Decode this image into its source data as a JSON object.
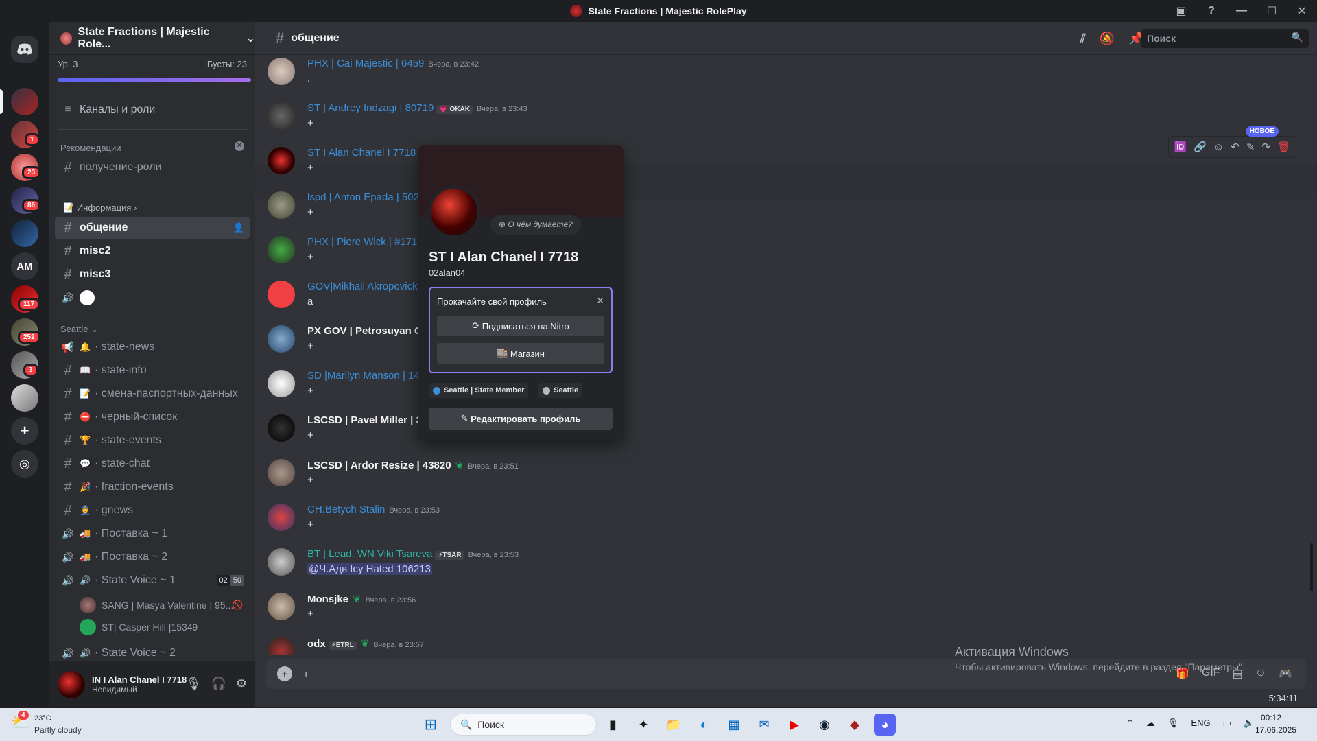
{
  "window": {
    "title": "State Fractions | Majestic RolePlay"
  },
  "rail": {
    "servers": [
      {
        "name": "server-1",
        "badge": ""
      },
      {
        "name": "server-2",
        "badge": "1"
      },
      {
        "name": "server-3",
        "badge": "23"
      },
      {
        "name": "server-4",
        "badge": "86"
      },
      {
        "name": "server-5",
        "badge": ""
      },
      {
        "name": "server-am",
        "label": "AM",
        "badge": ""
      },
      {
        "name": "server-7",
        "badge": "117"
      },
      {
        "name": "server-8",
        "badge": "252"
      },
      {
        "name": "server-9",
        "badge": "3"
      },
      {
        "name": "server-10",
        "badge": ""
      }
    ],
    "add_icon": "+",
    "discover_icon": "compass-icon"
  },
  "sidebar": {
    "server_name": "State Fractions | Majestic Role...",
    "level": "Ур. 3",
    "boosts": "Бусты: 23",
    "channels_and_roles": "Каналы и роли",
    "recommendations": "Рекомендации",
    "rec_channel": "получение-роли",
    "info_category": "Информация",
    "channels": [
      {
        "label": "общение",
        "active": true
      },
      {
        "label": "misc2"
      },
      {
        "label": "misc3"
      }
    ],
    "seattle_category": "Seattle",
    "seattle_channels": [
      {
        "emoji": "🔔",
        "label": "state-news",
        "type": "announce"
      },
      {
        "emoji": "📖",
        "label": "state-info"
      },
      {
        "emoji": "📝",
        "label": "смена-паспортных-данных"
      },
      {
        "emoji": "⛔",
        "label": "черный-список"
      },
      {
        "emoji": "🏆",
        "label": "state-events"
      },
      {
        "emoji": "💬",
        "label": "state-chat"
      },
      {
        "emoji": "🎉",
        "label": "fraction-events"
      },
      {
        "emoji": "👮",
        "label": "gnews"
      },
      {
        "emoji": "🚚",
        "label": "Поставка ~ 1",
        "type": "voice"
      },
      {
        "emoji": "🚚",
        "label": "Поставка ~ 2",
        "type": "voice"
      },
      {
        "emoji": "🔊",
        "label": "State Voice ~ 1",
        "type": "voice",
        "count1": "02",
        "count2": "50"
      }
    ],
    "voice_users": [
      "SANG | Masya Valentine | 95...",
      "ST| Casper Hill |15349"
    ],
    "state_voice_2": "State Voice ~ 2"
  },
  "user_panel": {
    "name": "IN I Alan Chanel I 7718",
    "status": "Невидимый"
  },
  "chat": {
    "channel": "общение",
    "search_placeholder": "Поиск",
    "new_label": "НОВОЕ",
    "messages": [
      {
        "author": "PHX | Cai Majestic | 6459",
        "color": "#3b8ed8",
        "time": "Вчера, в 23:42",
        "text": "."
      },
      {
        "author": "ST | Andrey Indzagi | 80719",
        "color": "#3b8ed8",
        "tag": "💗 OKAK",
        "time": "Вчера, в 23:43",
        "text": "+"
      },
      {
        "author": "ST I Alan Chanel I 7718",
        "color": "#3b8ed8",
        "time": "",
        "text": "+"
      },
      {
        "author": "lspd | Anton Epada | 502",
        "color": "#3b8ed8",
        "time": "",
        "text": "+"
      },
      {
        "author": "PHX | Piere Wick | #1718",
        "color": "#3b8ed8",
        "time": "",
        "text": "+"
      },
      {
        "author": "GOV|Mikhail Akropovick",
        "color": "#3b8ed8",
        "time": "",
        "text": "a"
      },
      {
        "author": "PX GOV | Petrosuyan Ch",
        "color": "#f2f3f5",
        "time": "",
        "text": "+"
      },
      {
        "author": "SD |Marilyn Manson | 14",
        "color": "#3b8ed8",
        "time": "",
        "text": "+"
      },
      {
        "author": "LSCSD | Pavel Miller | 3",
        "color": "#f2f3f5",
        "time": "",
        "text": "+"
      },
      {
        "author": "LSCSD | Ardor Resize | 43820",
        "color": "#f2f3f5",
        "time": "Вчера, в 23:51",
        "text": "+"
      },
      {
        "author": "CH.Betych Stalin",
        "color": "#3b8ed8",
        "time": "Вчера, в 23:53",
        "text": "+"
      },
      {
        "author": "BT | Lead. WN Viki Tsareva",
        "color": "#2fb5a8",
        "tag": "⚡TSAR",
        "time": "Вчера, в 23:53",
        "text": "@Ч.Адв Icy Hated 106213",
        "mention": true
      },
      {
        "author": "Monsjke",
        "color": "#f2f3f5",
        "time": "Вчера, в 23:56",
        "text": "+"
      },
      {
        "author": "odx",
        "color": "#f2f3f5",
        "tag": "⚡ETRL",
        "time": "Вчера, в 23:57",
        "text": ""
      }
    ],
    "composer_text": "+",
    "clock": "5:34:11",
    "watermark_title": "Активация Windows",
    "watermark_text": "Чтобы активировать Windows, перейдите в раздел \"Параметры\"."
  },
  "popout": {
    "think_placeholder": "О чём думаете?",
    "name": "ST I Alan Chanel I 7718",
    "handle": "02alan04",
    "nitro_title": "Прокачайте свой профиль",
    "nitro_button": "Подписаться на Nitro",
    "shop_button": "Магазин",
    "roles": [
      {
        "label": "Seattle | State Member",
        "color": "#3b8ed8"
      },
      {
        "label": "Seattle",
        "color": "#b5bac1"
      }
    ],
    "edit_button": "Редактировать профиль"
  },
  "taskbar": {
    "weather_temp": "23°C",
    "weather_desc": "Partly cloudy",
    "weather_badge": "4",
    "search": "Поиск",
    "lang": "ENG",
    "time": "00:12",
    "date": "17.06.2025"
  }
}
